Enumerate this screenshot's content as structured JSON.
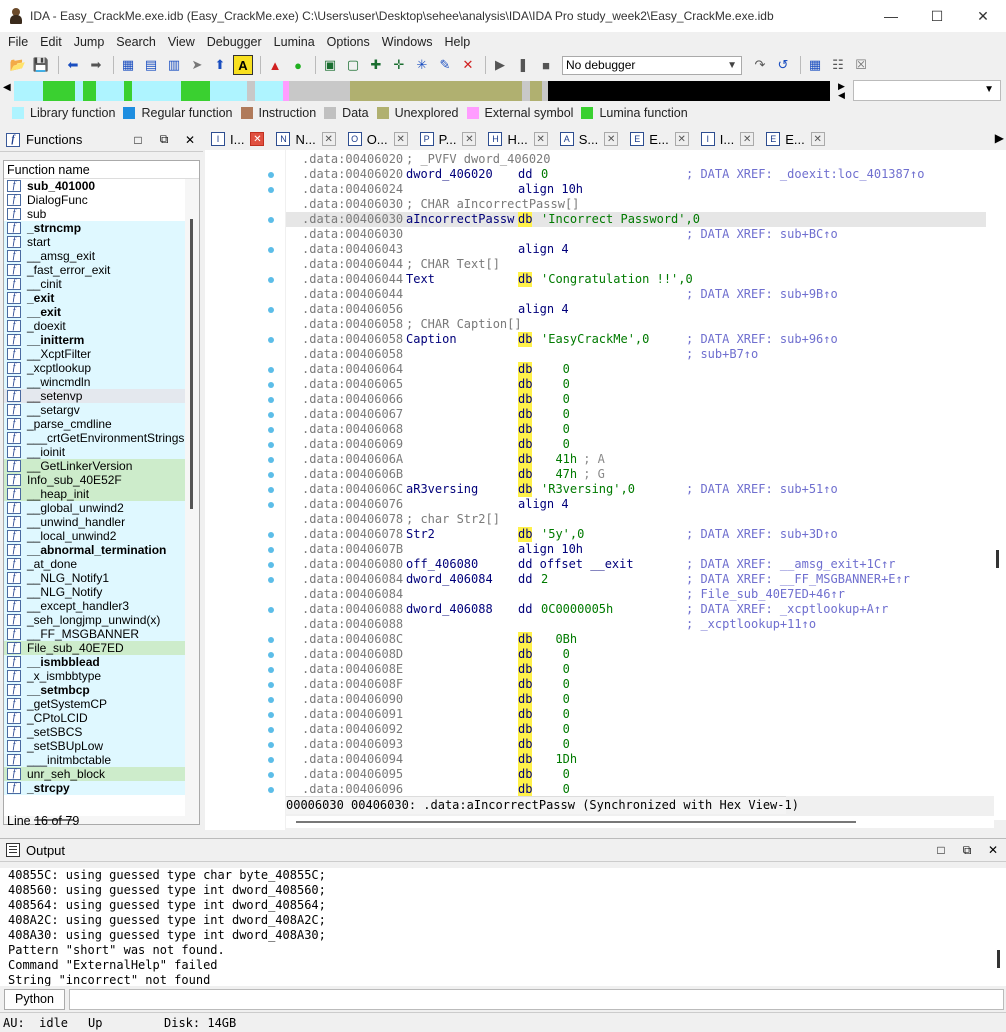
{
  "window": {
    "title": "IDA - Easy_CrackMe.exe.idb (Easy_CrackMe.exe) C:\\Users\\user\\Desktop\\sehee\\analysis\\IDA\\IDA Pro study_week2\\Easy_CrackMe.exe.idb",
    "minimize": "—",
    "maximize": "☐",
    "close": "✕"
  },
  "menu": [
    "File",
    "Edit",
    "Jump",
    "Search",
    "View",
    "Debugger",
    "Lumina",
    "Options",
    "Windows",
    "Help"
  ],
  "toolbar": {
    "debugger_select": "No debugger"
  },
  "navband": {
    "segments": [
      {
        "color": "#aef4ff",
        "w": 3.5
      },
      {
        "color": "#3ad030",
        "w": 4.0
      },
      {
        "color": "#aef4ff",
        "w": 1.0
      },
      {
        "color": "#3ad030",
        "w": 1.5
      },
      {
        "color": "#aef4ff",
        "w": 3.5
      },
      {
        "color": "#3ad030",
        "w": 1.0
      },
      {
        "color": "#aef4ff",
        "w": 6.0
      },
      {
        "color": "#3ad030",
        "w": 3.5
      },
      {
        "color": "#aef4ff",
        "w": 4.5
      },
      {
        "color": "#c8c8c8",
        "w": 1.0
      },
      {
        "color": "#aef4ff",
        "w": 3.5
      },
      {
        "color": "#ff9cff",
        "w": 0.7
      },
      {
        "color": "#c8c8c8",
        "w": 7.5
      },
      {
        "color": "#b0b070",
        "w": 21.0
      },
      {
        "color": "#c8c8c8",
        "w": 1.0
      },
      {
        "color": "#b0b070",
        "w": 1.5
      },
      {
        "color": "#c8c8c8",
        "w": 0.7
      },
      {
        "color": "#000000",
        "w": 35.6
      }
    ]
  },
  "legend": [
    {
      "label": "Library function",
      "color": "#aef4ff"
    },
    {
      "label": "Regular function",
      "color": "#1e8ee0"
    },
    {
      "label": "Instruction",
      "color": "#b07a5a"
    },
    {
      "label": "Data",
      "color": "#c0c0c0"
    },
    {
      "label": "Unexplored",
      "color": "#b0b070"
    },
    {
      "label": "External symbol",
      "color": "#ff9cff"
    },
    {
      "label": "Lumina function",
      "color": "#3ad030"
    }
  ],
  "functions_panel": {
    "title": "Functions",
    "column": "Function name",
    "line_status": "Line 16 of 79",
    "items": [
      {
        "name": "sub_401000",
        "bold": true,
        "kind": "regular"
      },
      {
        "name": "DialogFunc",
        "bold": false,
        "kind": "regular"
      },
      {
        "name": "sub",
        "bold": false,
        "kind": "regular"
      },
      {
        "name": "_strncmp",
        "bold": true,
        "kind": "lib"
      },
      {
        "name": "start",
        "bold": false,
        "kind": "lib"
      },
      {
        "name": "__amsg_exit",
        "bold": false,
        "kind": "lib"
      },
      {
        "name": "_fast_error_exit",
        "bold": false,
        "kind": "lib"
      },
      {
        "name": "__cinit",
        "bold": false,
        "kind": "lib"
      },
      {
        "name": "_exit",
        "bold": true,
        "kind": "lib"
      },
      {
        "name": "__exit",
        "bold": true,
        "kind": "lib"
      },
      {
        "name": "_doexit",
        "bold": false,
        "kind": "lib"
      },
      {
        "name": "__initterm",
        "bold": true,
        "kind": "lib"
      },
      {
        "name": "__XcptFilter",
        "bold": false,
        "kind": "lib"
      },
      {
        "name": "_xcptlookup",
        "bold": false,
        "kind": "lib"
      },
      {
        "name": "__wincmdln",
        "bold": false,
        "kind": "lib"
      },
      {
        "name": "__setenvp",
        "bold": false,
        "kind": "sel"
      },
      {
        "name": "__setargv",
        "bold": false,
        "kind": "lib"
      },
      {
        "name": "_parse_cmdline",
        "bold": false,
        "kind": "lib"
      },
      {
        "name": "___crtGetEnvironmentStrings",
        "bold": false,
        "kind": "lib"
      },
      {
        "name": "__ioinit",
        "bold": false,
        "kind": "lib"
      },
      {
        "name": "__GetLinkerVersion",
        "bold": false,
        "kind": "lum"
      },
      {
        "name": "Info_sub_40E52F",
        "bold": false,
        "kind": "lum"
      },
      {
        "name": "__heap_init",
        "bold": false,
        "kind": "lum"
      },
      {
        "name": "__global_unwind2",
        "bold": false,
        "kind": "lib"
      },
      {
        "name": "__unwind_handler",
        "bold": false,
        "kind": "lib"
      },
      {
        "name": "__local_unwind2",
        "bold": false,
        "kind": "lib"
      },
      {
        "name": "__abnormal_termination",
        "bold": true,
        "kind": "lib"
      },
      {
        "name": "_at_done",
        "bold": false,
        "kind": "lib"
      },
      {
        "name": "__NLG_Notify1",
        "bold": false,
        "kind": "lib"
      },
      {
        "name": "__NLG_Notify",
        "bold": false,
        "kind": "lib"
      },
      {
        "name": "__except_handler3",
        "bold": false,
        "kind": "lib"
      },
      {
        "name": "_seh_longjmp_unwind(x)",
        "bold": false,
        "kind": "lib"
      },
      {
        "name": "__FF_MSGBANNER",
        "bold": false,
        "kind": "lib"
      },
      {
        "name": "File_sub_40E7ED",
        "bold": false,
        "kind": "lum"
      },
      {
        "name": "__ismbblead",
        "bold": true,
        "kind": "lib"
      },
      {
        "name": "_x_ismbbtype",
        "bold": false,
        "kind": "lib"
      },
      {
        "name": "__setmbcp",
        "bold": true,
        "kind": "lib"
      },
      {
        "name": "_getSystemCP",
        "bold": false,
        "kind": "lib"
      },
      {
        "name": "_CPtoLCID",
        "bold": false,
        "kind": "lib"
      },
      {
        "name": "_setSBCS",
        "bold": false,
        "kind": "lib"
      },
      {
        "name": "_setSBUpLow",
        "bold": false,
        "kind": "lib"
      },
      {
        "name": "___initmbctable",
        "bold": false,
        "kind": "lib"
      },
      {
        "name": "unr_seh_block",
        "bold": false,
        "kind": "lum"
      },
      {
        "name": "_strcpy",
        "bold": true,
        "kind": "lib"
      }
    ]
  },
  "tabs": [
    {
      "icon": "I",
      "label": "I...",
      "active": true
    },
    {
      "icon": "N",
      "label": "N...",
      "active": false
    },
    {
      "icon": "O",
      "label": "O...",
      "active": false
    },
    {
      "icon": "P",
      "label": "P...",
      "active": false
    },
    {
      "icon": "H",
      "label": "H...",
      "active": false
    },
    {
      "icon": "A",
      "label": "S...",
      "active": false
    },
    {
      "icon": "E",
      "label": "E...",
      "active": false
    },
    {
      "icon": "I",
      "label": "I...",
      "active": false
    },
    {
      "icon": "E",
      "label": "E...",
      "active": false
    }
  ],
  "disasm": {
    "status": "00006030 00406030: .data:aIncorrectPassw (Synchronized with Hex View-1)",
    "lines": [
      {
        "addr": ".data:00406020",
        "cmt": "; _PVFV dword_406020"
      },
      {
        "addr": ".data:00406020",
        "lbl": "dword_406020",
        "ins": "dd",
        "op": "0",
        "xref": "; DATA XREF: _doexit:loc_401387↑o"
      },
      {
        "addr": ".data:00406024",
        "ins": "align 10h"
      },
      {
        "addr": ".data:00406030",
        "cmt": "; CHAR aIncorrectPassw[]"
      },
      {
        "addr": ".data:00406030",
        "lbl": "aIncorrectPassw",
        "ins": "db",
        "db": true,
        "op": "'Incorrect Password',0",
        "hl": true
      },
      {
        "addr": ".data:00406030",
        "xref": "; DATA XREF: sub+BC↑o"
      },
      {
        "addr": ".data:00406043",
        "ins": "align 4"
      },
      {
        "addr": ".data:00406044",
        "cmt": "; CHAR Text[]"
      },
      {
        "addr": ".data:00406044",
        "lbl": "Text",
        "ins": "db",
        "db": true,
        "op": "'Congratulation !!',0"
      },
      {
        "addr": ".data:00406044",
        "xref": "; DATA XREF: sub+9B↑o"
      },
      {
        "addr": ".data:00406056",
        "ins": "align 4"
      },
      {
        "addr": ".data:00406058",
        "cmt": "; CHAR Caption[]"
      },
      {
        "addr": ".data:00406058",
        "lbl": "Caption",
        "ins": "db",
        "db": true,
        "op": "'EasyCrackMe',0",
        "xref": "; DATA XREF: sub+96↑o"
      },
      {
        "addr": ".data:00406058",
        "xref": "; sub+B7↑o"
      },
      {
        "addr": ".data:00406064",
        "ins": "db",
        "db": true,
        "op": "   0"
      },
      {
        "addr": ".data:00406065",
        "ins": "db",
        "db": true,
        "op": "   0"
      },
      {
        "addr": ".data:00406066",
        "ins": "db",
        "db": true,
        "op": "   0"
      },
      {
        "addr": ".data:00406067",
        "ins": "db",
        "db": true,
        "op": "   0"
      },
      {
        "addr": ".data:00406068",
        "ins": "db",
        "db": true,
        "op": "   0"
      },
      {
        "addr": ".data:00406069",
        "ins": "db",
        "db": true,
        "op": "   0"
      },
      {
        "addr": ".data:0040606A",
        "ins": "db",
        "db": true,
        "op": "  41h",
        "inl": " ; A"
      },
      {
        "addr": ".data:0040606B",
        "ins": "db",
        "db": true,
        "op": "  47h",
        "inl": " ; G"
      },
      {
        "addr": ".data:0040606C",
        "lbl": "aR3versing",
        "ins": "db",
        "db": true,
        "op": "'R3versing',0",
        "xref": "; DATA XREF: sub+51↑o"
      },
      {
        "addr": ".data:00406076",
        "ins": "align 4"
      },
      {
        "addr": ".data:00406078",
        "cmt": "; char Str2[]"
      },
      {
        "addr": ".data:00406078",
        "lbl": "Str2",
        "ins": "db",
        "db": true,
        "op": "'5y',0",
        "xref": "; DATA XREF: sub+3D↑o"
      },
      {
        "addr": ".data:0040607B",
        "ins": "align 10h"
      },
      {
        "addr": ".data:00406080",
        "lbl": "off_406080",
        "ins": "dd offset __exit",
        "xref": "; DATA XREF: __amsg_exit+1C↑r"
      },
      {
        "addr": ".data:00406084",
        "lbl": "dword_406084",
        "ins": "dd",
        "op": "2",
        "xref": "; DATA XREF: __FF_MSGBANNER+E↑r"
      },
      {
        "addr": ".data:00406084",
        "xref": "; File_sub_40E7ED+46↑r"
      },
      {
        "addr": ".data:00406088",
        "lbl": "dword_406088",
        "ins": "dd",
        "op": "0C0000005h",
        "xref": "; DATA XREF: _xcptlookup+A↑r"
      },
      {
        "addr": ".data:00406088",
        "xref": "; _xcptlookup+11↑o"
      },
      {
        "addr": ".data:0040608C",
        "ins": "db",
        "db": true,
        "op": "  0Bh"
      },
      {
        "addr": ".data:0040608D",
        "ins": "db",
        "db": true,
        "op": "   0"
      },
      {
        "addr": ".data:0040608E",
        "ins": "db",
        "db": true,
        "op": "   0"
      },
      {
        "addr": ".data:0040608F",
        "ins": "db",
        "db": true,
        "op": "   0"
      },
      {
        "addr": ".data:00406090",
        "ins": "db",
        "db": true,
        "op": "   0"
      },
      {
        "addr": ".data:00406091",
        "ins": "db",
        "db": true,
        "op": "   0"
      },
      {
        "addr": ".data:00406092",
        "ins": "db",
        "db": true,
        "op": "   0"
      },
      {
        "addr": ".data:00406093",
        "ins": "db",
        "db": true,
        "op": "   0"
      },
      {
        "addr": ".data:00406094",
        "ins": "db",
        "db": true,
        "op": "  1Dh"
      },
      {
        "addr": ".data:00406095",
        "ins": "db",
        "db": true,
        "op": "   0"
      },
      {
        "addr": ".data:00406096",
        "ins": "db",
        "db": true,
        "op": "   0"
      }
    ]
  },
  "output": {
    "title": "Output",
    "lines": [
      "40855C: using guessed type char byte_40855C;",
      "408560: using guessed type int dword_408560;",
      "408564: using guessed type int dword_408564;",
      "408A2C: using guessed type int dword_408A2C;",
      "408A30: using guessed type int dword_408A30;",
      "Pattern \"short\" was not found.",
      "Command \"ExternalHelp\" failed",
      "String \"incorrect\" not found"
    ],
    "python_button": "Python"
  },
  "statusbar": {
    "au": "AU:  idle",
    "mode": "Up",
    "disk": "Disk: 14GB"
  }
}
